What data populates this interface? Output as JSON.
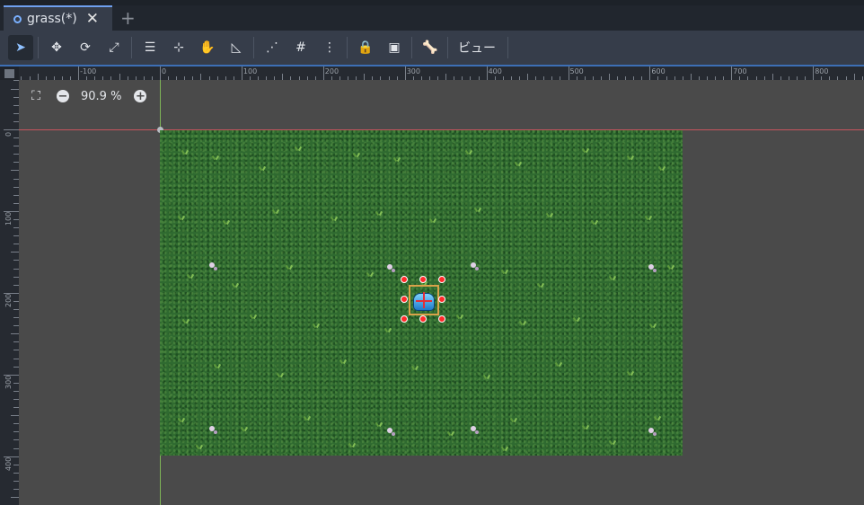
{
  "tab": {
    "title": "grass(*)",
    "close_icon": "close-icon",
    "add_icon": "plus-icon"
  },
  "toolbar": {
    "tools": [
      {
        "name": "select-tool",
        "glyph": "➤",
        "selected": true
      },
      {
        "name": "move-tool",
        "glyph": "✥"
      },
      {
        "name": "rotate-tool",
        "glyph": "⟳"
      },
      {
        "name": "scale-tool",
        "glyph": "⤢"
      },
      {
        "name": "list-select-tool",
        "glyph": "☰"
      },
      {
        "name": "pivot-tool",
        "glyph": "⊹"
      },
      {
        "name": "pan-tool",
        "glyph": "✋"
      },
      {
        "name": "ruler-tool",
        "glyph": "◺"
      },
      {
        "name": "smart-snap-toggle",
        "glyph": "⋰"
      },
      {
        "name": "grid-snap-toggle",
        "glyph": "#"
      },
      {
        "name": "snap-options-menu",
        "glyph": "⋮"
      },
      {
        "name": "lock-tool",
        "glyph": "🔒"
      },
      {
        "name": "group-tool",
        "glyph": "▣"
      },
      {
        "name": "skeleton-tool",
        "glyph": "🦴"
      }
    ],
    "view_menu": "ビュー"
  },
  "ruler": {
    "top_labels": [
      "-100",
      "0",
      "100",
      "200",
      "300",
      "400",
      "500",
      "600",
      "700",
      "800"
    ],
    "left_labels": [
      "0",
      "100",
      "200",
      "300",
      "400"
    ]
  },
  "zoom": {
    "level": "90.9 %",
    "center_icon": "zoom-center-icon",
    "minus_icon": "zoom-out-icon",
    "plus_icon": "zoom-in-icon"
  },
  "colors": {
    "accent": "#6fa0ef",
    "x_axis": "#c7545e",
    "y_axis": "#7db356",
    "grass": "#2f6a30",
    "handle": "#ff2a2a",
    "selection": "#d9a24a"
  }
}
